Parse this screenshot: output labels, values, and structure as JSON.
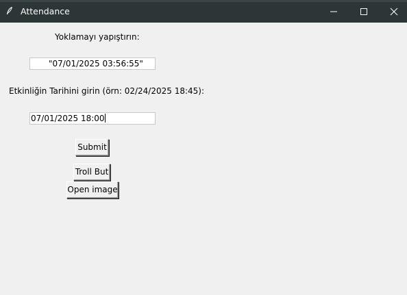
{
  "window": {
    "title": "Attendance"
  },
  "icons": {
    "app": "feather-icon",
    "minimize": "minimize-icon",
    "maximize": "maximize-icon",
    "close": "close-icon"
  },
  "form": {
    "paste_label": "Yoklamayı yapıştırın:",
    "paste_value": "\"07/01/2025 03:56:55\"          \"\"",
    "date_label": "Etkinliğin Tarihini girin (örn: 02/24/2025 18:45):",
    "date_value": "07/01/2025 18:00"
  },
  "buttons": {
    "submit": "Submit",
    "troll": "Troll But",
    "open_image": "Open image"
  },
  "colors": {
    "titlebar": "#2d3636",
    "background": "#f0f0f0",
    "entry_bg": "#ffffff"
  }
}
